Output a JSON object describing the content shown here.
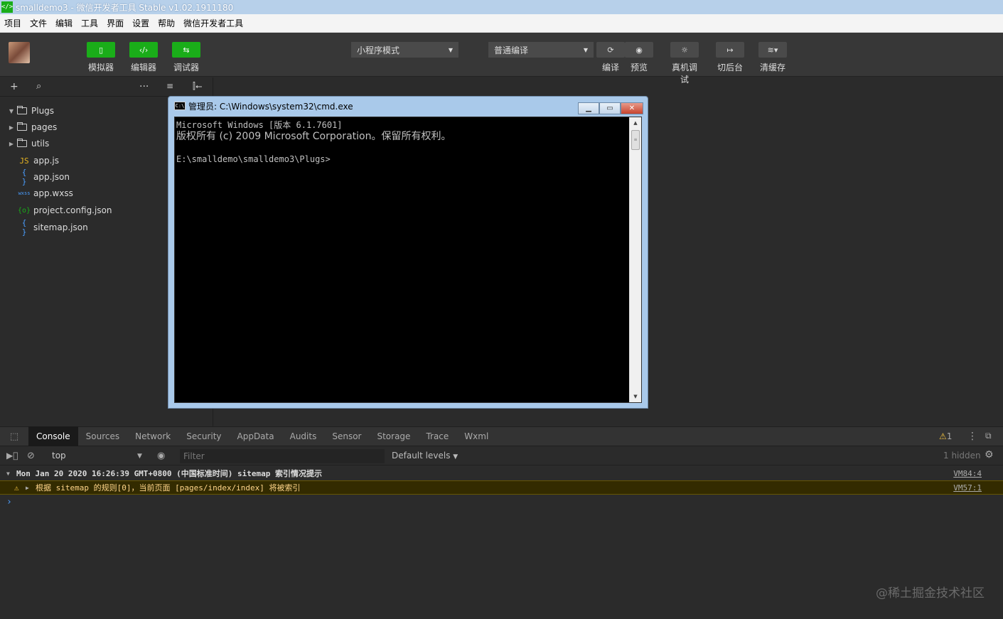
{
  "window": {
    "title": "smalldemo3 - 微信开发者工具 Stable v1.02.1911180",
    "icon": "wechat-devtools-icon"
  },
  "menu": [
    "项目",
    "文件",
    "编辑",
    "工具",
    "界面",
    "设置",
    "帮助",
    "微信开发者工具"
  ],
  "toolbar": {
    "simulator": "模拟器",
    "editor": "编辑器",
    "debugger": "调试器",
    "mode_select": "小程序模式",
    "compile_select": "普通编译",
    "compile": "编译",
    "preview": "预览",
    "remote_debug": "真机调试",
    "background": "切后台",
    "clear_cache": "清缓存"
  },
  "file_tree": [
    {
      "name": "Plugs",
      "type": "folder",
      "expanded": true
    },
    {
      "name": "pages",
      "type": "folder",
      "expanded": false
    },
    {
      "name": "utils",
      "type": "folder",
      "expanded": false
    },
    {
      "name": "app.js",
      "type": "js",
      "badge": "JS"
    },
    {
      "name": "app.json",
      "type": "json",
      "badge": "{ }"
    },
    {
      "name": "app.wxss",
      "type": "wxss",
      "badge": "wxss"
    },
    {
      "name": "project.config.json",
      "type": "config",
      "badge": "{o}"
    },
    {
      "name": "sitemap.json",
      "type": "json",
      "badge": "{ }"
    }
  ],
  "cmd": {
    "title": "管理员: C:\\Windows\\system32\\cmd.exe",
    "line1": "Microsoft Windows [版本 6.1.7601]",
    "line2": "版权所有 (c) 2009 Microsoft Corporation。保留所有权利。",
    "line3": "",
    "line4": "E:\\smalldemo\\smalldemo3\\Plugs>"
  },
  "devtools": {
    "tabs": [
      "Console",
      "Sources",
      "Network",
      "Security",
      "AppData",
      "Audits",
      "Sensor",
      "Storage",
      "Trace",
      "Wxml"
    ],
    "active_tab": "Console",
    "warning_count": "1",
    "context": "top",
    "filter_placeholder": "Filter",
    "levels": "Default levels",
    "hidden": "1 hidden"
  },
  "console_rows": {
    "group_header": "Mon Jan 20 2020 16:26:39 GMT+0800 (中国标准时间) sitemap 索引情况提示",
    "group_source": "VM84:4",
    "warning": "根据 sitemap 的规则[0]，当前页面 [pages/index/index] 将被索引",
    "warning_source": "VM57:1",
    "prompt": "›"
  },
  "watermark": "@稀土掘金技术社区",
  "colors": {
    "accent": "#1aad19",
    "bg": "#2b2b2b",
    "warning_bg": "#332b00",
    "warning_text": "#ffd58a"
  }
}
